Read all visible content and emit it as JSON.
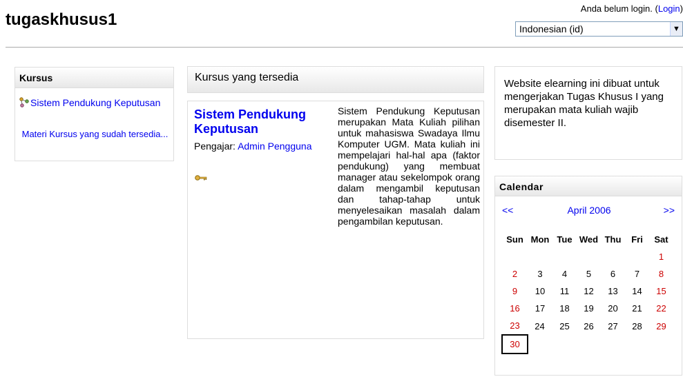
{
  "site": {
    "title": "tugaskhusus1"
  },
  "login": {
    "text": "Anda belum login.",
    "link": "Login",
    "open": "(",
    "close": ")"
  },
  "language": {
    "selected": "Indonesian (id)"
  },
  "courses_block": {
    "title": "Kursus",
    "course": "Sistem Pendukung Keputusan",
    "more": "Materi Kursus yang sudah tersedia..."
  },
  "available": {
    "title": "Kursus yang tersedia",
    "course_title": "Sistem Pendukung Keputusan",
    "teacher_label": "Pengajar:",
    "teacher_name": "Admin Pengguna",
    "summary": "Sistem Pendukung Keputusan merupakan Mata Kuliah pilihan untuk mahasiswa Swadaya Ilmu Komputer UGM. Mata kuliah ini mempelajari hal-hal apa (faktor pendukung) yang membuat manager atau sekelompok orang dalam mengambil keputusan dan tahap-tahap untuk menyelesaikan masalah dalam pengambilan keputusan."
  },
  "description": {
    "text": "Website elearning ini dibuat untuk mengerjakan Tugas Khusus I yang merupakan mata kuliah wajib disemester II."
  },
  "calendar": {
    "title": "Calendar",
    "prev": "<<",
    "next": ">>",
    "month": "April 2006",
    "weekdays": [
      "Sun",
      "Mon",
      "Tue",
      "Wed",
      "Thu",
      "Fri",
      "Sat"
    ],
    "weeks": [
      [
        "",
        "",
        "",
        "",
        "",
        "",
        "1"
      ],
      [
        "2",
        "3",
        "4",
        "5",
        "6",
        "7",
        "8"
      ],
      [
        "9",
        "10",
        "11",
        "12",
        "13",
        "14",
        "15"
      ],
      [
        "16",
        "17",
        "18",
        "19",
        "20",
        "21",
        "22"
      ],
      [
        "23",
        "24",
        "25",
        "26",
        "27",
        "28",
        "29"
      ],
      [
        "30",
        "",
        "",
        "",
        "",
        "",
        ""
      ]
    ],
    "today": "30",
    "weekend_color": "#cc0000"
  }
}
